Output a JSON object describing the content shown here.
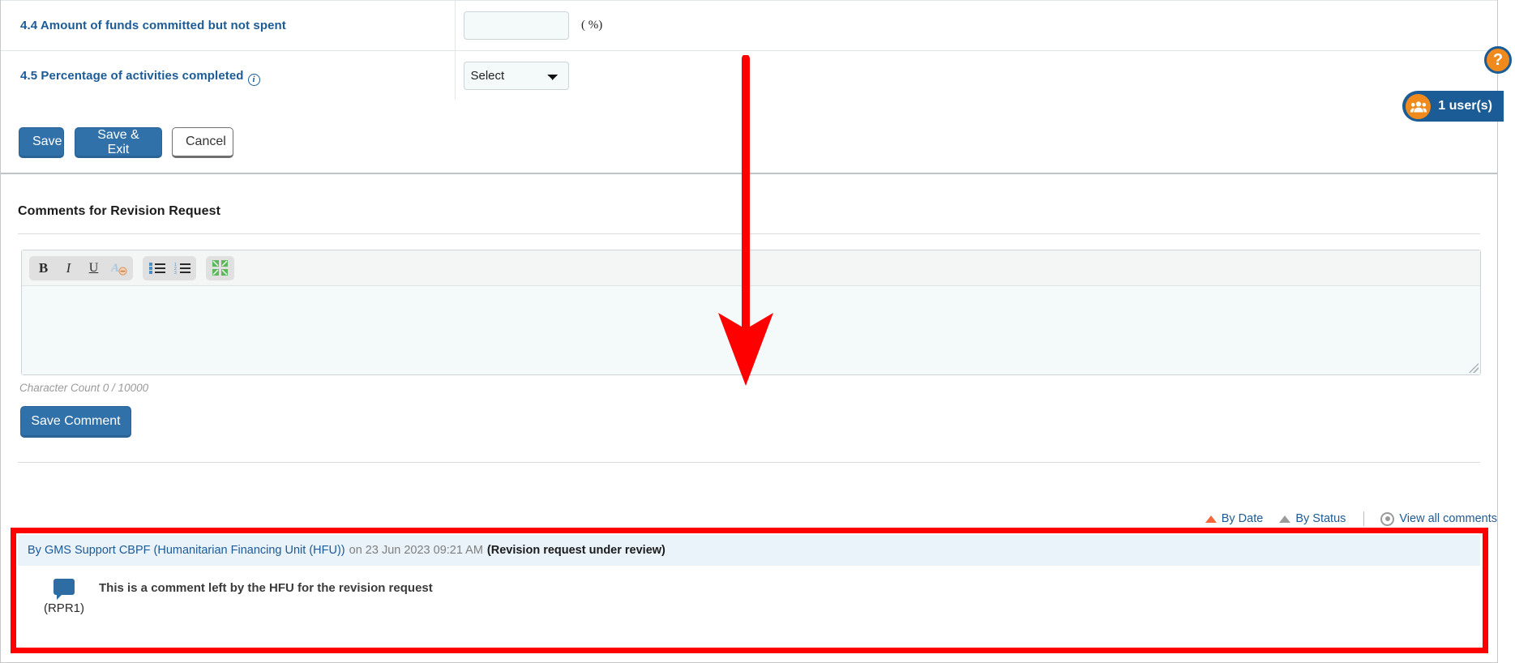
{
  "form": {
    "rows": [
      {
        "id": "4.4",
        "label": "4.4 Amount of funds committed but not spent",
        "has_info_icon": false,
        "control": "text",
        "value": "",
        "placeholder": "",
        "suffix": "( %)"
      },
      {
        "id": "4.5",
        "label": "4.5 Percentage of activities completed",
        "has_info_icon": true,
        "info_icon": "info-circle-icon",
        "control": "select",
        "selected": "Select",
        "options": [
          "Select"
        ],
        "suffix": ""
      }
    ]
  },
  "actions": {
    "save_label": "Save",
    "save_exit_label": "Save & Exit",
    "cancel_label": "Cancel"
  },
  "comments_section": {
    "title": "Comments for Revision Request",
    "editor": {
      "toolbar": [
        {
          "name": "bold-icon",
          "glyph": "B",
          "title": "Bold"
        },
        {
          "name": "italic-icon",
          "glyph": "I",
          "title": "Italic"
        },
        {
          "name": "underline-icon",
          "glyph": "U",
          "title": "Underline"
        },
        {
          "name": "remove-format-icon",
          "glyph": "A",
          "title": "Remove Format"
        },
        {
          "name": "bulleted-list-icon",
          "glyph": "",
          "title": "Insert/Remove Bulleted List"
        },
        {
          "name": "numbered-list-icon",
          "glyph": "",
          "title": "Insert/Remove Numbered List"
        },
        {
          "name": "maximize-icon",
          "glyph": "",
          "title": "Maximize"
        }
      ],
      "body_text": "",
      "character_count": "Character Count 0 / 10000"
    },
    "save_comment_label": "Save Comment",
    "sort": {
      "by_date_label": "By Date",
      "by_status_label": "By Status",
      "view_all_label": "View all comments",
      "by_date_icon": "sort-ascending-icon",
      "by_status_icon": "sort-ascending-icon",
      "view_all_icon": "eye-icon"
    },
    "comment": {
      "author_prefix": "By GMS Support CBPF (Humanitarian Financing Unit (HFU))",
      "meta": "on 23 Jun 2023 09:21 AM",
      "status": "(Revision request under review)",
      "ref": "(RPR1)",
      "bubble_icon": "comment-bubble-icon",
      "text": "This is a comment left by the HFU for the revision request"
    }
  },
  "floating": {
    "help_label": "?",
    "help_icon": "question-mark-icon",
    "users_label": "1 user(s)",
    "users_icon": "users-group-icon"
  },
  "annotations": {
    "arrow_color": "#fe0000",
    "box_color": "#fe0000"
  },
  "colors": {
    "primary_button": "#3071a9",
    "link_blue": "#1c5b96",
    "accent_orange": "#f08a1c",
    "field_bg": "#f4fafa",
    "comment_header_bg": "#eaf2fa"
  }
}
